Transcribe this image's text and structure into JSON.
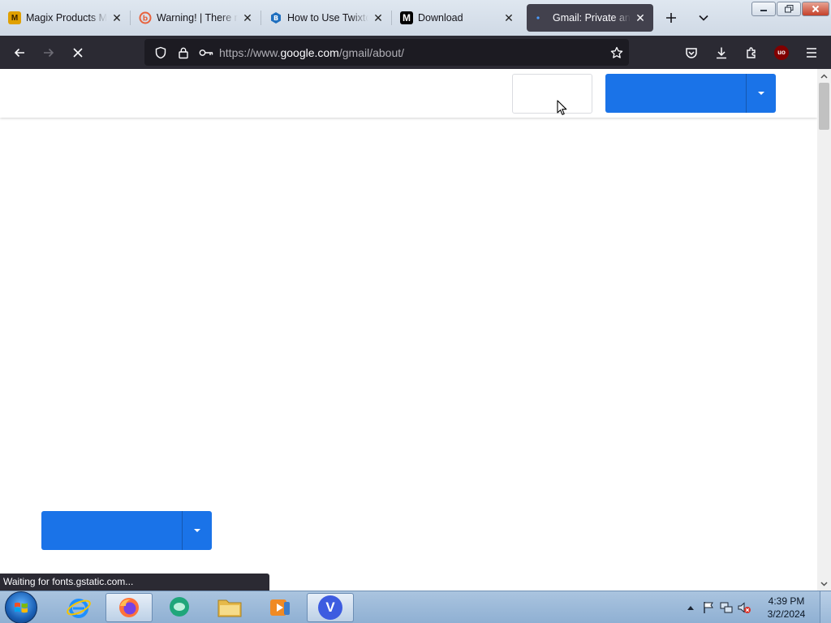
{
  "browser": {
    "tabs": [
      {
        "title": "Magix Products Mu",
        "icon": "magix-icon",
        "color": "#e0a000"
      },
      {
        "title": "Warning! | There m",
        "icon": "warning-site-icon",
        "color": "#e8613c"
      },
      {
        "title": "How to Use Twixtor",
        "icon": "twixtor-icon",
        "color": "#1f6fbf"
      },
      {
        "title": "Download",
        "icon": "medium-icon",
        "color": "#000000"
      },
      {
        "title": "Gmail: Private and s",
        "icon": "loading-icon",
        "color": "#4a9cff",
        "active": true
      }
    ],
    "url_prefix": "https://www.",
    "url_host": "google.com",
    "url_path": "/gmail/about/",
    "extension_badge": "uo"
  },
  "page": {
    "signin_label": "",
    "header_cta_label": "",
    "body_cta_label": "",
    "accent": "#1a73e8"
  },
  "status": {
    "text": "Waiting for fonts.gstatic.com..."
  },
  "taskbar": {
    "apps": [
      "internet-explorer-icon",
      "firefox-icon",
      "chat-icon",
      "file-explorer-icon",
      "media-player-icon",
      "v-app-icon"
    ],
    "v_letter": "V",
    "time": "4:39 PM",
    "date": "3/2/2024"
  }
}
